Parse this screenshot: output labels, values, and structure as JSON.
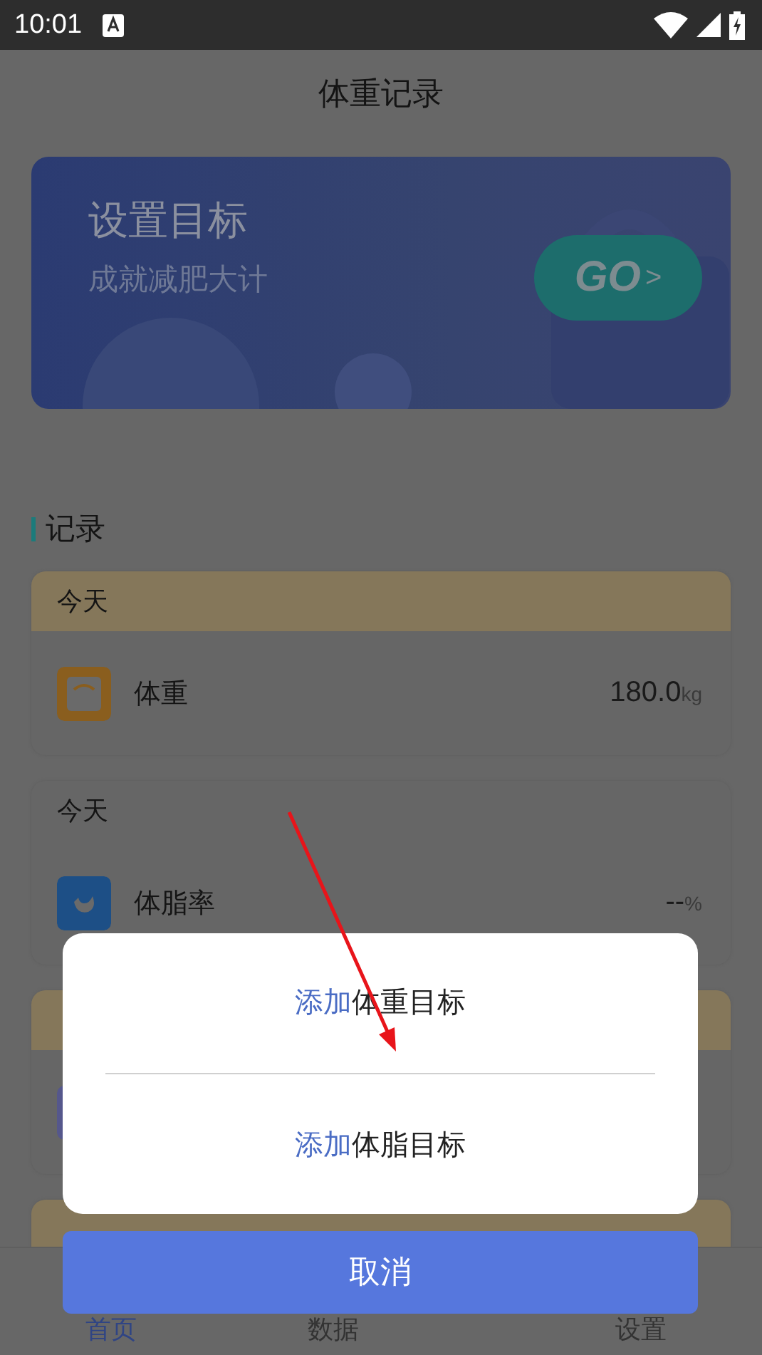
{
  "status_bar": {
    "time": "10:01"
  },
  "header": {
    "title": "体重记录"
  },
  "banner": {
    "title": "设置目标",
    "subtitle": "成就减肥大计",
    "button": {
      "label": "GO",
      "arrow": ">"
    }
  },
  "section": {
    "title": "记录"
  },
  "records": [
    {
      "highlighted": true,
      "date": "今天",
      "kind": "weight",
      "name": "体重",
      "value": "180.0",
      "unit": "kg",
      "color": "#8a5e1e"
    },
    {
      "highlighted": false,
      "date": "今天",
      "kind": "fat",
      "name": "体脂率",
      "value": "--",
      "unit": "%",
      "color": "#1d4f86"
    },
    {
      "highlighted": true,
      "color": "#55578c"
    },
    {
      "highlighted": true
    }
  ],
  "nav": [
    {
      "label": "首页",
      "selected": true
    },
    {
      "label": "数据",
      "selected": false
    },
    {
      "label": "设置",
      "selected": false
    }
  ],
  "sheet": {
    "options": [
      {
        "accent": "添加",
        "text": "体重目标"
      },
      {
        "accent": "添加",
        "text": "体脂目标"
      }
    ],
    "cancel": "取消"
  }
}
